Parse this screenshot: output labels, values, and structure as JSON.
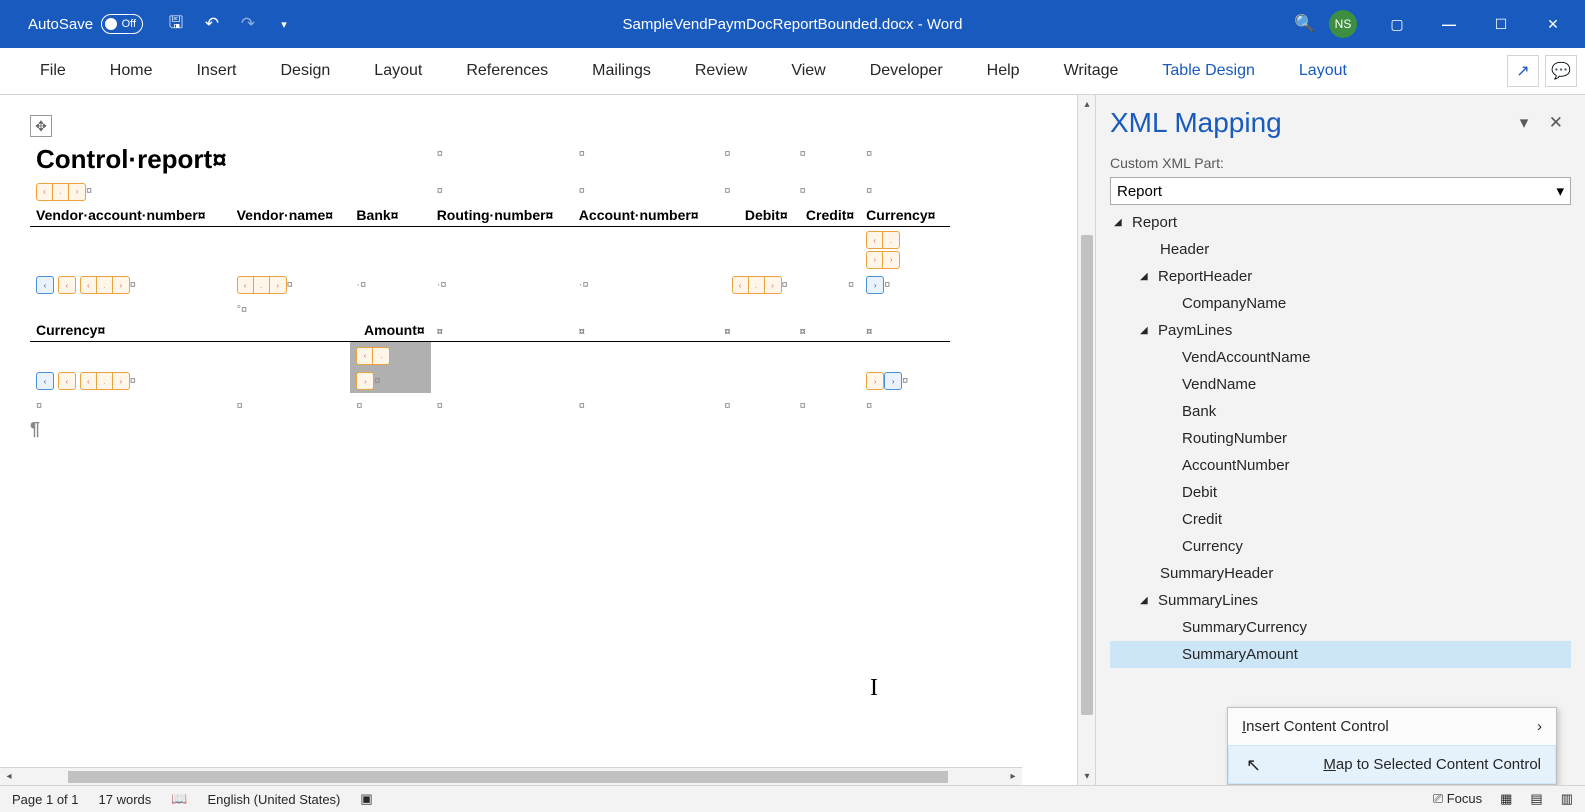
{
  "titlebar": {
    "autosave_label": "AutoSave",
    "autosave_state": "Off",
    "doc_title": "SampleVendPaymDocReportBounded.docx - Word",
    "account_initials": "NS"
  },
  "ribbon": {
    "tabs": [
      "File",
      "Home",
      "Insert",
      "Design",
      "Layout",
      "References",
      "Mailings",
      "Review",
      "View",
      "Developer",
      "Help",
      "Writage"
    ],
    "context_tabs": [
      "Table Design",
      "Layout"
    ]
  },
  "document": {
    "heading": "Control·report¤",
    "columns": {
      "vend_account": "Vendor·account·number¤",
      "vend_name": "Vendor·name¤",
      "bank": "Bank¤",
      "routing": "Routing·number¤",
      "account": "Account·number¤",
      "debit": "Debit¤",
      "credit": "Credit¤",
      "currency": "Currency¤"
    },
    "summary_cols": {
      "currency": "Currency¤",
      "amount": "Amount¤"
    }
  },
  "pane": {
    "title": "XML Mapping",
    "part_label": "Custom XML Part:",
    "part_value": "Report",
    "tree": {
      "root": "Report",
      "n1": "Header",
      "n2": "ReportHeader",
      "n2a": "CompanyName",
      "n3": "PaymLines",
      "n3a": "VendAccountName",
      "n3b": "VendName",
      "n3c": "Bank",
      "n3d": "RoutingNumber",
      "n3e": "AccountNumber",
      "n3f": "Debit",
      "n3g": "Credit",
      "n3h": "Currency",
      "n4": "SummaryHeader",
      "n5": "SummaryLines",
      "n5a": "SummaryCurrency",
      "n5b": "SummaryAmount"
    },
    "context_menu": {
      "item1_prefix": "I",
      "item1_rest": "nsert Content Control",
      "item2": "Map to Selected Content Control"
    }
  },
  "statusbar": {
    "page": "Page 1 of 1",
    "words": "17 words",
    "lang": "English (United States)",
    "focus": "Focus"
  }
}
